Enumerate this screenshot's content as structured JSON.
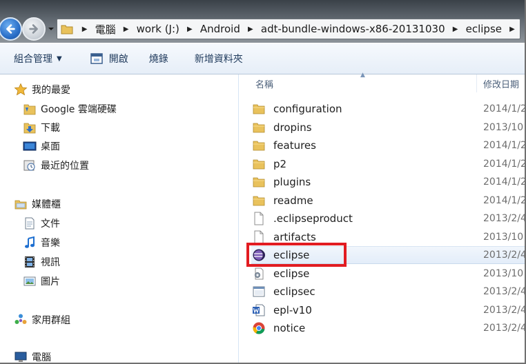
{
  "address_bar": {
    "breadcrumbs": [
      "電腦",
      "work (J:)",
      "Android",
      "adt-bundle-windows-x86-20131030",
      "eclipse"
    ]
  },
  "toolbar": {
    "organize_label": "組合管理",
    "open_label": "開啟",
    "burn_label": "燒錄",
    "new_folder_label": "新增資料夾"
  },
  "nav": {
    "favorites": "我的最愛",
    "google_drive": "Google 雲端硬碟",
    "downloads": "下載",
    "desktop": "桌面",
    "recent": "最近的位置",
    "libraries": "媒體櫃",
    "documents": "文件",
    "music": "音樂",
    "videos": "視訊",
    "pictures": "圖片",
    "homegroup": "家用群組",
    "computer": "電腦"
  },
  "columns": {
    "name": "名稱",
    "date_modified": "修改日期"
  },
  "files": [
    {
      "name": "configuration",
      "date": "2014/1/2",
      "icon": "folder-icon"
    },
    {
      "name": "dropins",
      "date": "2013/10",
      "icon": "folder-icon"
    },
    {
      "name": "features",
      "date": "2014/1/2",
      "icon": "folder-icon"
    },
    {
      "name": "p2",
      "date": "2014/1/2",
      "icon": "folder-icon"
    },
    {
      "name": "plugins",
      "date": "2014/1/2",
      "icon": "folder-icon"
    },
    {
      "name": "readme",
      "date": "2014/1/2",
      "icon": "folder-icon"
    },
    {
      "name": ".eclipseproduct",
      "date": "2013/2/4",
      "icon": "file-icon"
    },
    {
      "name": "artifacts",
      "date": "2013/10",
      "icon": "file-icon"
    },
    {
      "name": "eclipse",
      "date": "2013/2/4",
      "icon": "eclipse-icon"
    },
    {
      "name": "eclipse",
      "date": "2013/10",
      "icon": "config-file-icon"
    },
    {
      "name": "eclipsec",
      "date": "2013/2/4",
      "icon": "console-app-icon"
    },
    {
      "name": "epl-v10",
      "date": "2013/2/4",
      "icon": "word-doc-icon"
    },
    {
      "name": "notice",
      "date": "2013/2/4",
      "icon": "chrome-html-icon"
    }
  ],
  "colors": {
    "highlight": "#e21c21",
    "folder": "#e9c25c",
    "toolbar_text": "#1e395b"
  }
}
